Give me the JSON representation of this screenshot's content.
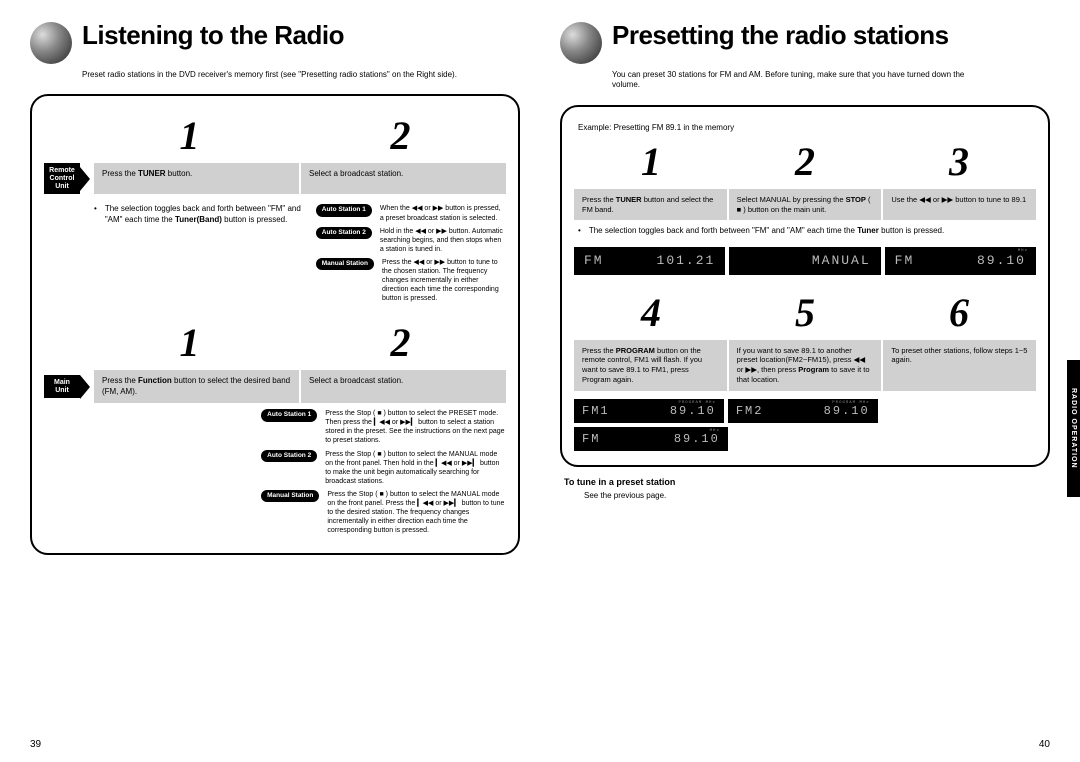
{
  "left": {
    "title": "Listening to the Radio",
    "intro": "Preset radio stations in the DVD receiver's memory first (see \"Presetting radio stations\" on the Right side).",
    "label_remote": "Remote Control Unit",
    "label_main": "Main Unit",
    "row1": {
      "nums": [
        "1",
        "2"
      ],
      "cell1_a": "Press the ",
      "cell1_bold": "TUNER",
      "cell1_b": " button.",
      "cell2": "Select a broadcast station.",
      "note_a": "The selection toggles back and forth between \"FM\" and \"AM\" each time the ",
      "note_bold": "Tuner(Band)",
      "note_b": " button is pressed.",
      "pills": [
        {
          "label": "Auto Station 1",
          "text": "When the ◀◀ or ▶▶ button is pressed, a preset broadcast station is selected."
        },
        {
          "label": "Auto Station 2",
          "text": "Hold in the ◀◀ or ▶▶ button. Automatic searching begins, and then stops when a station is tuned in."
        },
        {
          "label": "Manual Station",
          "text": "Press the ◀◀ or ▶▶ button to tune to the chosen station. The frequency changes incrementally in either direction each time the corresponding button is pressed."
        }
      ]
    },
    "row2": {
      "nums": [
        "1",
        "2"
      ],
      "cell1_a": "Press the ",
      "cell1_bold": "Function",
      "cell1_b": " button to select the desired band (FM, AM).",
      "cell2": "Select a broadcast station.",
      "pills": [
        {
          "label": "Auto Station 1",
          "text": "Press the Stop ( ■ ) button to select the PRESET mode. Then press the ▎◀◀ or ▶▶▎ button to select a station stored in the preset. See the instructions on the next page to preset stations."
        },
        {
          "label": "Auto Station 2",
          "text": "Press the Stop ( ■ ) button to select the MANUAL mode on the front panel. Then hold in the ▎◀◀ or ▶▶▎ button to make the unit begin automatically searching for broadcast stations."
        },
        {
          "label": "Manual Station",
          "text": "Press the Stop ( ■ ) button to select the MANUAL mode on the front panel. Press the ▎◀◀ or ▶▶▎ button to tune to the desired station. The frequency changes incrementally in either direction each time the corresponding button is pressed."
        }
      ]
    },
    "page_num": "39"
  },
  "right": {
    "title": "Presetting the radio stations",
    "intro": "You can preset 30 stations for FM and AM. Before tuning, make sure that you have turned down the volume.",
    "example": "Example: Presetting FM 89.1 in the memory",
    "block_a": {
      "nums": [
        "1",
        "2",
        "3"
      ],
      "c1_a": "Press the ",
      "c1_bold": "TUNER",
      "c1_b": " button  and select the FM band.",
      "c2_a": "Select MANUAL by pressing the ",
      "c2_bold": "STOP",
      "c2_b": " ( ■ )   button on the main unit.",
      "c3": "Use the  ◀◀  or  ▶▶ button to tune to 89.1",
      "note_a": "The selection toggles back and forth between \"FM\" and \"AM\" each time the ",
      "note_bold": "Tuner",
      "note_b": " button is pressed.",
      "lcd": [
        {
          "l": "FM",
          "r": "101.21"
        },
        {
          "l": "",
          "r": "MANUAL"
        },
        {
          "l": "FM",
          "r": "89.10",
          "tag": "MHz"
        }
      ]
    },
    "block_b": {
      "nums": [
        "4",
        "5",
        "6"
      ],
      "c1_a": "Press the ",
      "c1_bold": "PROGRAM",
      "c1_b": " button on the remote control, FM1 will flash. If you want to save 89.1 to FM1, press Program again.",
      "c2_a": "If you want to save 89.1 to another preset location(FM2~FM15), press ◀◀ or ▶▶, then press ",
      "c2_bold": "Program",
      "c2_b": " to save it to that location.",
      "c3": "To preset other stations, follow steps 1~5 again.",
      "lcd": [
        {
          "l": "FM1",
          "r": "89.10",
          "tag": "PROGRAM   MHz"
        },
        {
          "l": "FM2",
          "r": "89.10",
          "tag": "PROGRAM   MHz"
        },
        {
          "l": "FM",
          "r": "89.10",
          "tag": "MHz"
        }
      ]
    },
    "sub_heading": "To tune in a preset station",
    "sub_text": "See the previous page.",
    "side_tab": "RADIO OPERATION",
    "page_num": "40"
  }
}
